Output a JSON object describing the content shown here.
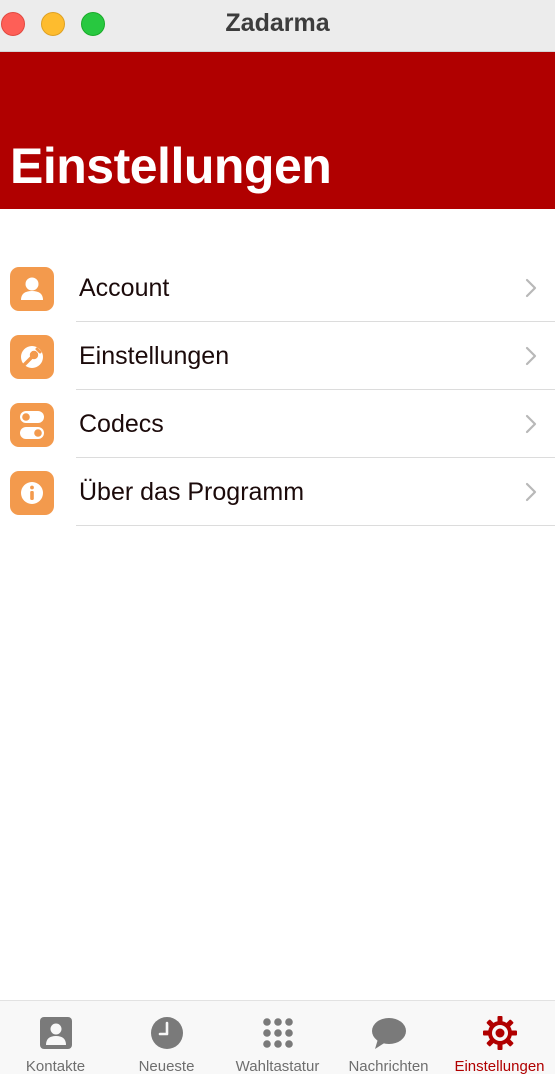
{
  "window": {
    "title": "Zadarma"
  },
  "header": {
    "title": "Einstellungen"
  },
  "menu": {
    "items": [
      {
        "label": "Account",
        "icon": "person-icon"
      },
      {
        "label": "Einstellungen",
        "icon": "wrench-icon"
      },
      {
        "label": "Codecs",
        "icon": "toggles-icon"
      },
      {
        "label": "Über das Programm",
        "icon": "info-icon"
      }
    ]
  },
  "tabbar": {
    "tabs": [
      {
        "label": "Kontakte",
        "icon": "contact-card-icon"
      },
      {
        "label": "Neueste",
        "icon": "clock-icon"
      },
      {
        "label": "Wahltastatur",
        "icon": "dialpad-icon"
      },
      {
        "label": "Nachrichten",
        "icon": "chat-bubble-icon"
      },
      {
        "label": "Einstellungen",
        "icon": "gear-icon",
        "active": true
      }
    ]
  },
  "colors": {
    "brand": "#b00000",
    "icon_bg": "#f39a4d",
    "tab_inactive": "#6e6e6e"
  }
}
